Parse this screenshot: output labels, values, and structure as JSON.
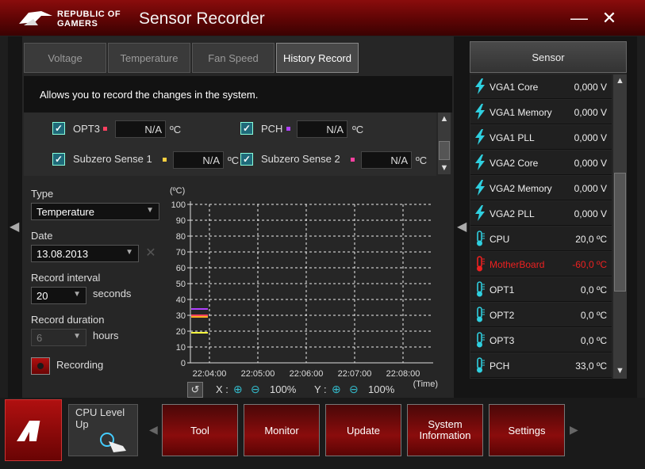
{
  "window": {
    "brand_line1": "REPUBLIC OF",
    "brand_line2": "GAMERS",
    "title": "Sensor Recorder",
    "minimize": "—",
    "close": "✕"
  },
  "tabs": [
    {
      "label": "Voltage"
    },
    {
      "label": "Temperature"
    },
    {
      "label": "Fan Speed"
    },
    {
      "label": "History Record"
    }
  ],
  "description": "Allows you to record the changes in the system.",
  "sensors": [
    {
      "label": "OPT3",
      "value": "N/A",
      "unit": "ºC",
      "color": "#ff4060"
    },
    {
      "label": "PCH",
      "value": "N/A",
      "unit": "ºC",
      "color": "#b040ff"
    },
    {
      "label": "Subzero Sense 1",
      "value": "N/A",
      "unit": "ºC",
      "color": "#ffd040"
    },
    {
      "label": "Subzero Sense 2",
      "value": "N/A",
      "unit": "ºC",
      "color": "#ff40a0"
    }
  ],
  "controls": {
    "type_label": "Type",
    "type_value": "Temperature",
    "date_label": "Date",
    "date_value": "13.08.2013",
    "interval_label": "Record interval",
    "interval_value": "20",
    "interval_unit": "seconds",
    "duration_label": "Record duration",
    "duration_value": "6",
    "duration_unit": "hours",
    "recording_label": "Recording"
  },
  "chart_data": {
    "type": "line",
    "ylabel": "(ºC)",
    "xlabel": "(Time)",
    "ylim": [
      0,
      100
    ],
    "yticks": [
      0,
      10,
      20,
      30,
      40,
      50,
      60,
      70,
      80,
      90,
      100
    ],
    "xticks": [
      "22:04:00",
      "22:05:00",
      "22:06:00",
      "22:07:00",
      "22:08:00"
    ],
    "grid": true,
    "series": [
      {
        "values": [
          34
        ],
        "color": "#b040ff"
      },
      {
        "values": [
          30
        ],
        "color": "#ff4060"
      },
      {
        "values": [
          29
        ],
        "color": "#ffb020"
      },
      {
        "values": [
          19
        ],
        "color": "#ffff40"
      }
    ],
    "zoom": {
      "x_label": "X :",
      "x_value": "100%",
      "y_label": "Y :",
      "y_value": "100%"
    }
  },
  "sensor_panel": {
    "header": "Sensor",
    "items": [
      {
        "name": "VGA1 Core",
        "value": "0,000",
        "unit": "V",
        "icon": "bolt-icon"
      },
      {
        "name": "VGA1 Memory",
        "value": "0,000",
        "unit": "V",
        "icon": "bolt-icon"
      },
      {
        "name": "VGA1 PLL",
        "value": "0,000",
        "unit": "V",
        "icon": "bolt-icon"
      },
      {
        "name": "VGA2 Core",
        "value": "0,000",
        "unit": "V",
        "icon": "bolt-icon"
      },
      {
        "name": "VGA2 Memory",
        "value": "0,000",
        "unit": "V",
        "icon": "bolt-icon"
      },
      {
        "name": "VGA2 PLL",
        "value": "0,000",
        "unit": "V",
        "icon": "bolt-icon"
      },
      {
        "name": "CPU",
        "value": "20,0",
        "unit": "ºC",
        "icon": "thermometer-icon"
      },
      {
        "name": "MotherBoard",
        "value": "-60,0",
        "unit": "ºC",
        "icon": "thermometer-icon",
        "alert": true
      },
      {
        "name": "OPT1",
        "value": "0,0",
        "unit": "ºC",
        "icon": "thermometer-icon"
      },
      {
        "name": "OPT2",
        "value": "0,0",
        "unit": "ºC",
        "icon": "thermometer-icon"
      },
      {
        "name": "OPT3",
        "value": "0,0",
        "unit": "ºC",
        "icon": "thermometer-icon"
      },
      {
        "name": "PCH",
        "value": "33,0",
        "unit": "ºC",
        "icon": "thermometer-icon"
      }
    ]
  },
  "bottom": {
    "cpu_level": "CPU Level Up",
    "nav": [
      "Tool",
      "Monitor",
      "Update",
      "System Information",
      "Settings"
    ]
  },
  "colors": {
    "accent": "#8a0c0c",
    "alert": "#ee2020",
    "icon": "#2fd0e0"
  }
}
